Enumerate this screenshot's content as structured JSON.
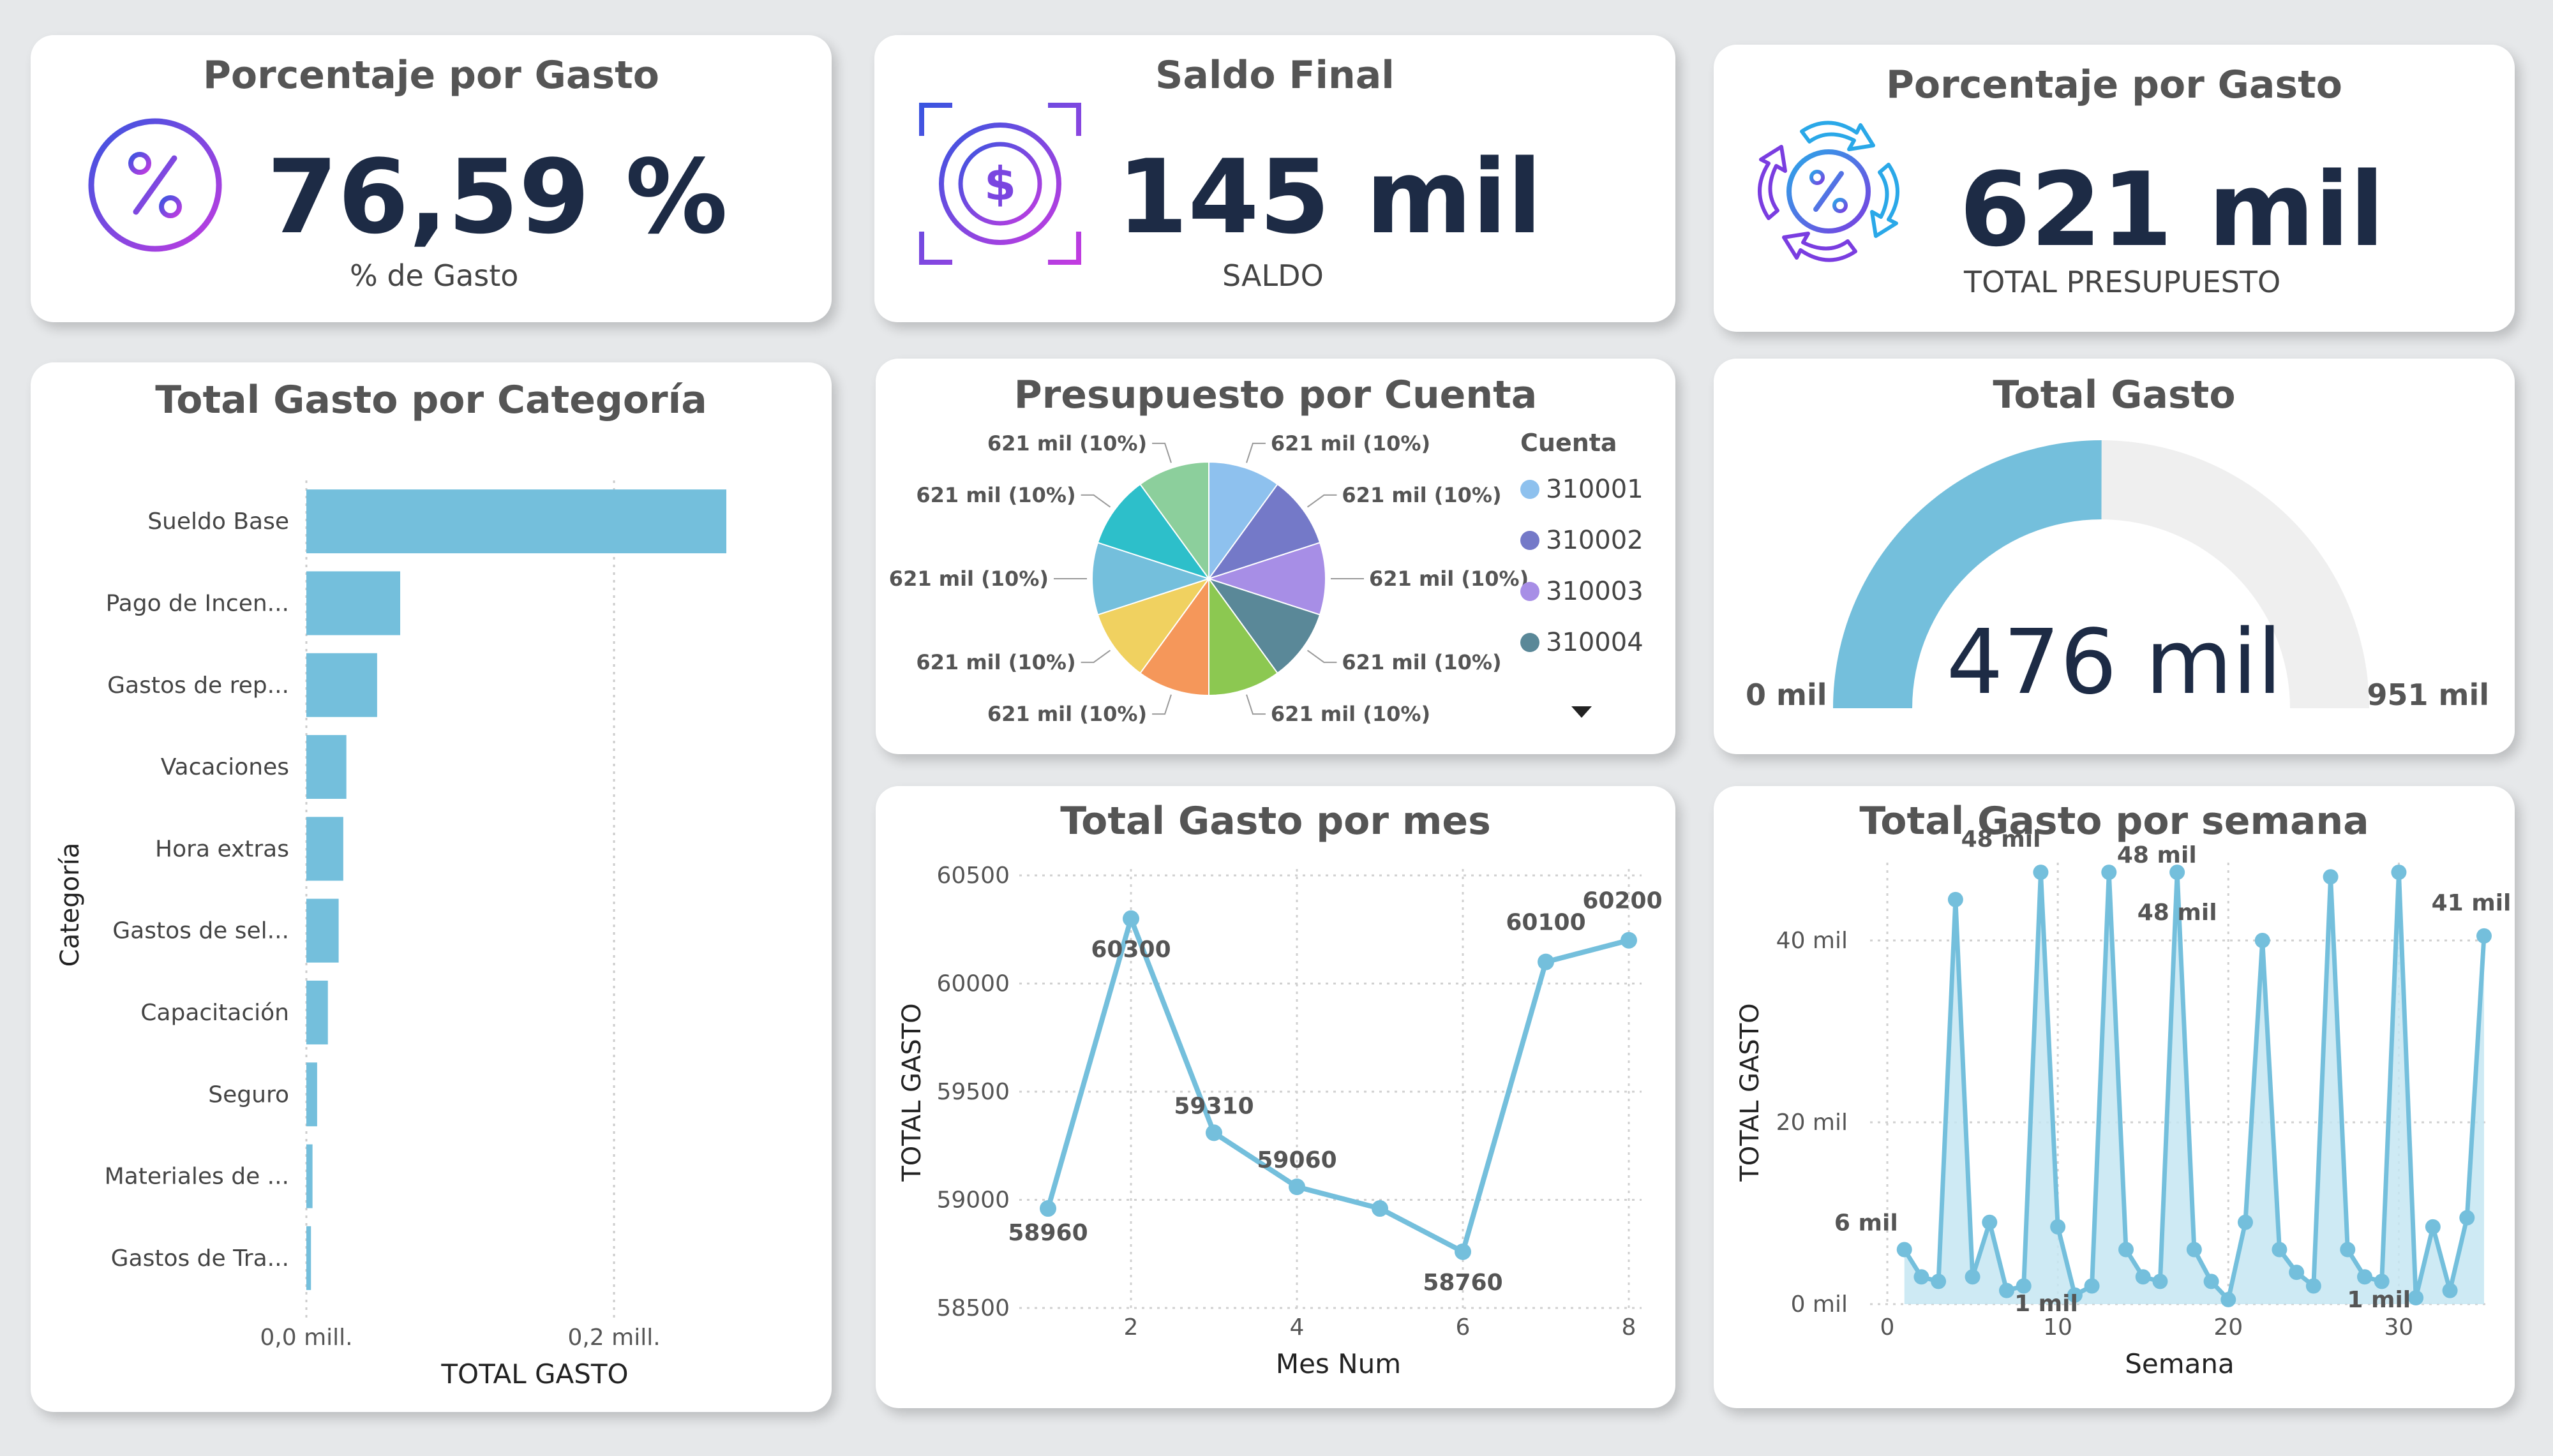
{
  "kpis": [
    {
      "title": "Porcentaje por Gasto",
      "value": "76,59 %",
      "label": "% de Gasto",
      "icon": "percent-circle-icon"
    },
    {
      "title": "Saldo Final",
      "value": "145 mil",
      "label": "SALDO",
      "icon": "dollar-frame-icon"
    },
    {
      "title": "Porcentaje por Gasto",
      "value": "621 mil",
      "label": "TOTAL PRESUPUESTO",
      "icon": "percent-cycle-icon"
    }
  ],
  "colors": {
    "bar": "#74bfdc",
    "line": "#74bfdc",
    "gauge_fill": "#74bfdc",
    "gauge_track": "#efefef",
    "kpi_value": "#1d2b45",
    "title": "#555555",
    "pie": [
      "#8ec1ee",
      "#7479c8",
      "#a78ee6",
      "#5a8898",
      "#8cc851",
      "#f5975a",
      "#f0d160",
      "#74bfdc",
      "#2dbfca",
      "#8ccf9c"
    ]
  },
  "bar_chart": {
    "title": "Total Gasto por Categoría",
    "xlabel": "TOTAL GASTO",
    "ylabel": "Categoría",
    "tick_labels": [
      "0,0 mill.",
      "0,2 mill."
    ],
    "categories": [
      "Sueldo Base",
      "Pago de Incen...",
      "Gastos de rep...",
      "Vacaciones",
      "Hora extras",
      "Gastos de sel...",
      "Capacitación",
      "Seguro",
      "Materiales de ...",
      "Gastos de Tra..."
    ]
  },
  "pie_chart": {
    "title": "Presupuesto por Cuenta",
    "legend_title": "Cuenta",
    "legend": [
      "310001",
      "310002",
      "310003",
      "310004"
    ],
    "slice_labels": [
      "621 mil (10%)",
      "621 mil (10%)",
      "621 mil (10%)",
      "621 mil (10%)",
      "621 mil (10%)",
      "621 mil (10%)",
      "621 mil (10%)",
      "621 mil (10%)",
      "621 mil (10%)",
      "621 mil (10%)"
    ]
  },
  "gauge": {
    "title": "Total Gasto",
    "value_label": "476 mil",
    "min_label": "0 mil",
    "max_label": "951 mil"
  },
  "line_chart": {
    "title": "Total Gasto por mes",
    "xlabel": "Mes Num",
    "ylabel": "TOTAL GASTO",
    "y_ticks": [
      "60500",
      "60000",
      "59500",
      "59000",
      "58500"
    ],
    "x_ticks": [
      "2",
      "4",
      "6",
      "8"
    ],
    "data_labels": [
      "58960",
      "60300",
      "59310",
      "59060",
      "58760",
      "60100",
      "60200"
    ]
  },
  "area_chart": {
    "title": "Total Gasto por semana",
    "xlabel": "Semana",
    "ylabel": "TOTAL GASTO",
    "y_ticks": [
      "40 mil",
      "20 mil",
      "0 mil"
    ],
    "x_ticks": [
      "0",
      "10",
      "20",
      "30"
    ],
    "data_labels": [
      "6 mil",
      "48 mil",
      "1 mil",
      "48 mil",
      "48 mil",
      "1 mil",
      "41 mil"
    ]
  },
  "chart_data": [
    {
      "type": "bar",
      "orientation": "horizontal",
      "title": "Total Gasto por Categoría",
      "xlabel": "TOTAL GASTO",
      "ylabel": "Categoría",
      "categories": [
        "Sueldo Base",
        "Pago de Incen...",
        "Gastos de rep...",
        "Vacaciones",
        "Hora extras",
        "Gastos de sel...",
        "Capacitación",
        "Seguro",
        "Materiales de ...",
        "Gastos de Tra..."
      ],
      "values": [
        0.273,
        0.061,
        0.046,
        0.026,
        0.024,
        0.021,
        0.014,
        0.007,
        0.004,
        0.003
      ],
      "unit": "mill.",
      "xlim": [
        0,
        0.273
      ],
      "grid": true
    },
    {
      "type": "pie",
      "title": "Presupuesto por Cuenta",
      "legend_title": "Cuenta",
      "legend_visible": [
        "310001",
        "310002",
        "310003",
        "310004"
      ],
      "values": [
        62.1,
        62.1,
        62.1,
        62.1,
        62.1,
        62.1,
        62.1,
        62.1,
        62.1,
        62.1
      ],
      "unit": "mil",
      "labels": [
        "621 mil (10%)",
        "621 mil (10%)",
        "621 mil (10%)",
        "621 mil (10%)",
        "621 mil (10%)",
        "621 mil (10%)",
        "621 mil (10%)",
        "621 mil (10%)",
        "621 mil (10%)",
        "621 mil (10%)"
      ],
      "legend_position": "right"
    },
    {
      "type": "gauge",
      "title": "Total Gasto",
      "value": 476,
      "min": 0,
      "max": 951,
      "unit": "mil"
    },
    {
      "type": "line",
      "title": "Total Gasto por mes",
      "xlabel": "Mes Num",
      "ylabel": "TOTAL GASTO",
      "x": [
        1,
        2,
        3,
        4,
        5,
        6,
        7,
        8
      ],
      "y": [
        58960,
        60300,
        59310,
        59060,
        58960,
        58760,
        60100,
        60200
      ],
      "labeled_points": [
        1,
        2,
        3,
        4,
        6,
        7,
        8
      ],
      "ylim": [
        58500,
        60500
      ],
      "xlim": [
        1,
        8
      ],
      "grid": true
    },
    {
      "type": "area",
      "title": "Total Gasto por semana",
      "xlabel": "Semana",
      "ylabel": "TOTAL GASTO",
      "x": [
        1,
        2,
        3,
        4,
        5,
        6,
        7,
        8,
        9,
        10,
        11,
        12,
        13,
        14,
        15,
        16,
        17,
        18,
        19,
        20,
        21,
        22,
        23,
        24,
        25,
        26,
        27,
        28,
        29,
        30,
        31,
        32,
        33,
        34,
        35
      ],
      "y": [
        6,
        3,
        2.5,
        44.5,
        3,
        9,
        1.5,
        2,
        47.5,
        8.5,
        1,
        2,
        47.5,
        6,
        3,
        2.5,
        47.5,
        6,
        2.5,
        0.5,
        9,
        40,
        6,
        3.5,
        2,
        47,
        6,
        3,
        2.5,
        47.5,
        0.7,
        8.5,
        1.5,
        9.5,
        40.5
      ],
      "unit": "mil",
      "ylim": [
        0,
        48
      ],
      "xlim": [
        0,
        35
      ],
      "grid": true
    }
  ]
}
